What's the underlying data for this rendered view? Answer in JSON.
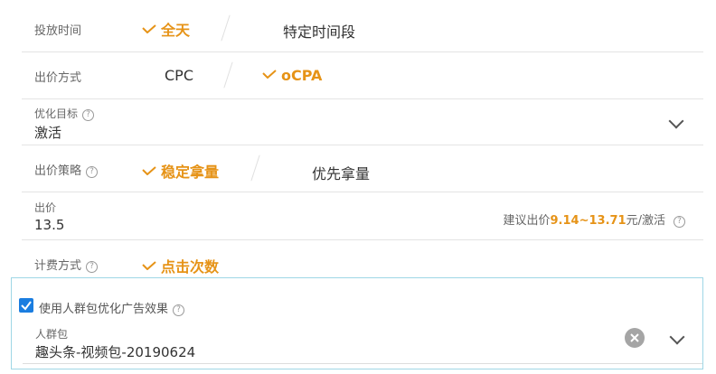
{
  "rows": {
    "schedule": {
      "label": "投放时间",
      "opt_all": "全天",
      "opt_specific": "特定时间段"
    },
    "bid_method": {
      "label": "出价方式",
      "opt_cpc": "CPC",
      "opt_ocpa": "oCPA"
    },
    "goal": {
      "label": "优化目标",
      "value": "激活"
    },
    "strategy": {
      "label": "出价策略",
      "opt_stable": "稳定拿量",
      "opt_priority": "优先拿量"
    },
    "bid": {
      "label": "出价",
      "value": "13.5",
      "hint_prefix": "建议出价",
      "hint_range": "9.14~13.71",
      "hint_suffix": "元/激活"
    },
    "billing": {
      "label": "计费方式",
      "opt_click": "点击次数"
    }
  },
  "audience": {
    "checkbox_label": "使用人群包优化广告效果",
    "field_label": "人群包",
    "value": "趣头条-视频包-20190624"
  },
  "colors": {
    "selected": "#e69317",
    "checkbox": "#1a7de0",
    "focus_border": "#9fd7e6"
  }
}
